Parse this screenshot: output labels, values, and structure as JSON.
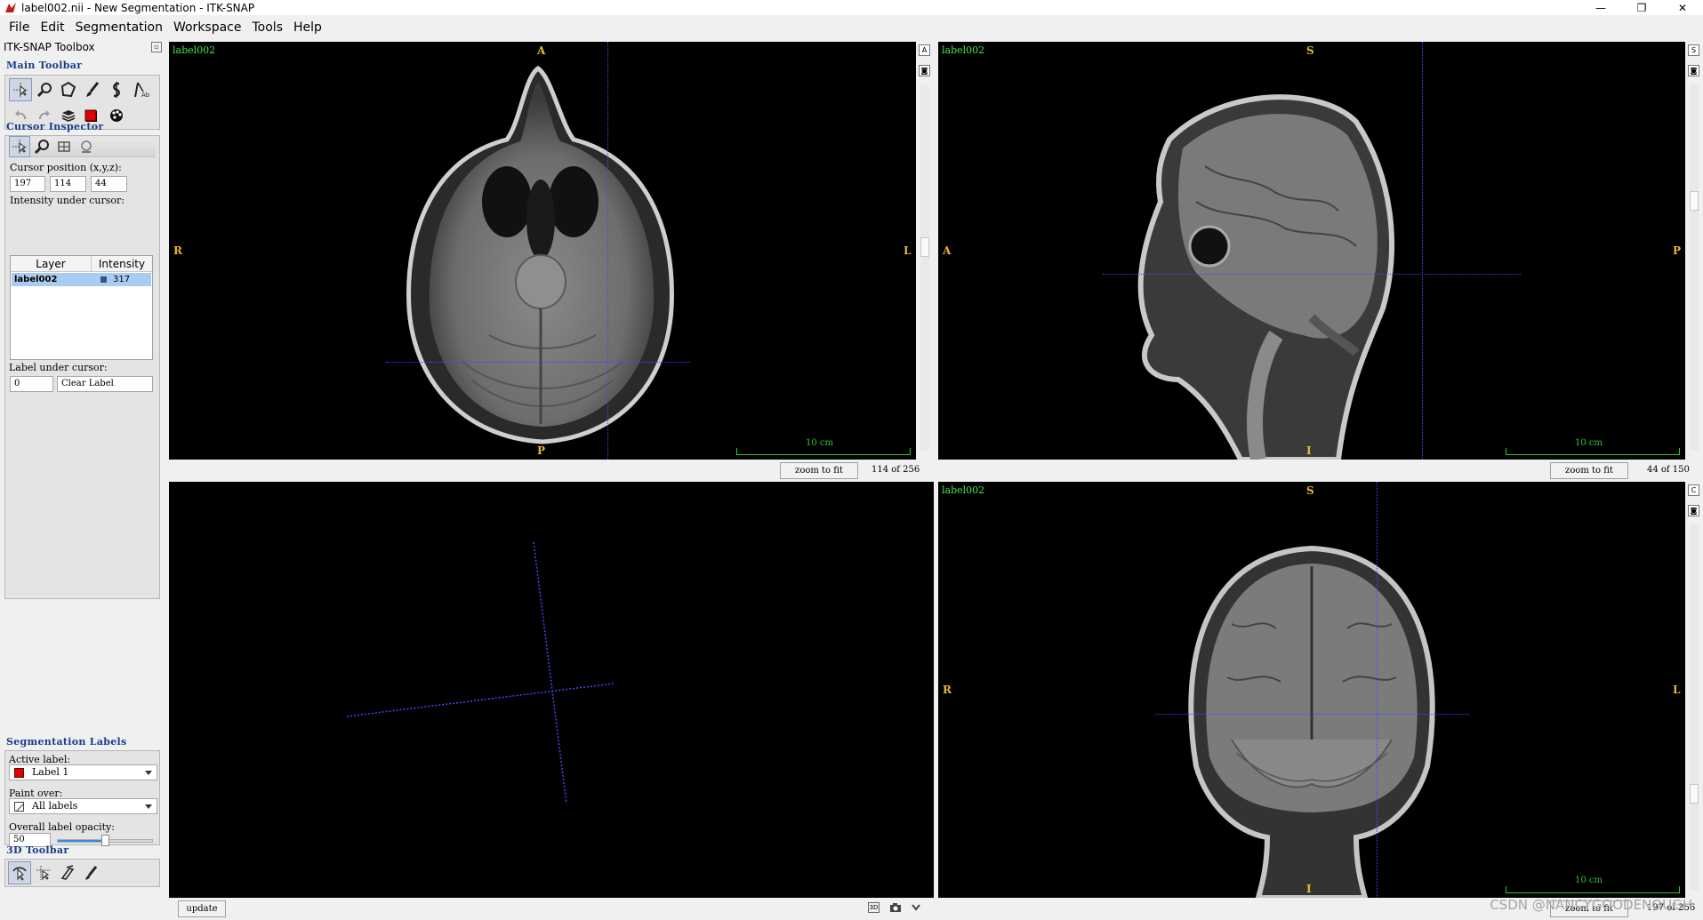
{
  "window": {
    "title": "label002.nii - New Segmentation - ITK-SNAP",
    "minimize": "—",
    "maximize": "❐",
    "close": "✕"
  },
  "menu": [
    "File",
    "Edit",
    "Segmentation",
    "Workspace",
    "Tools",
    "Help"
  ],
  "toolbox": {
    "title": "ITK-SNAP Toolbox",
    "main_toolbar_title": "Main Toolbar",
    "cursor_inspector_title": "Cursor Inspector",
    "cursor_position_label": "Cursor position (x,y,z):",
    "cursor_x": "197",
    "cursor_y": "114",
    "cursor_z": "44",
    "intensity_label": "Intensity under cursor:",
    "layer_header": "Layer",
    "intensity_header": "Intensity",
    "layer_name": "label002",
    "layer_value": "317",
    "label_under_cursor_label": "Label under cursor:",
    "label_id": "0",
    "label_name": "Clear Label",
    "seg_labels_title": "Segmentation Labels",
    "active_label_label": "Active label:",
    "active_label_value": "Label 1",
    "paint_over_label": "Paint over:",
    "paint_over_value": "All labels",
    "opacity_label": "Overall label opacity:",
    "opacity_value": "50",
    "opacity_fraction": 0.5,
    "toolbar3d_title": "3D Toolbar",
    "label_color": "#e00000"
  },
  "views": {
    "axial": {
      "layer": "label002",
      "top": "A",
      "bottom": "P",
      "left": "R",
      "right": "L",
      "scale": "10 cm",
      "zoom_btn": "zoom to fit",
      "slice": "114 of 256"
    },
    "sagittal": {
      "layer": "label002",
      "top": "S",
      "bottom": "I",
      "left": "A",
      "right": "P",
      "scale": "10 cm",
      "zoom_btn": "zoom to fit",
      "slice": "44 of 150"
    },
    "threeD": {
      "update_btn": "update"
    },
    "coronal": {
      "layer": "label002",
      "top": "S",
      "bottom": "I",
      "left": "R",
      "right": "L",
      "scale": "10 cm",
      "zoom_btn": "zoom to fit",
      "slice": "197 of 256"
    }
  },
  "watermark": "CSDN @NANCYGOODENOUGH",
  "colors": {
    "crosshair": "#3f49ff",
    "orientation": "#e8b631",
    "layer_label": "#41e84a",
    "scalebar": "#2ec52e",
    "section_title": "#1a3c8a"
  }
}
